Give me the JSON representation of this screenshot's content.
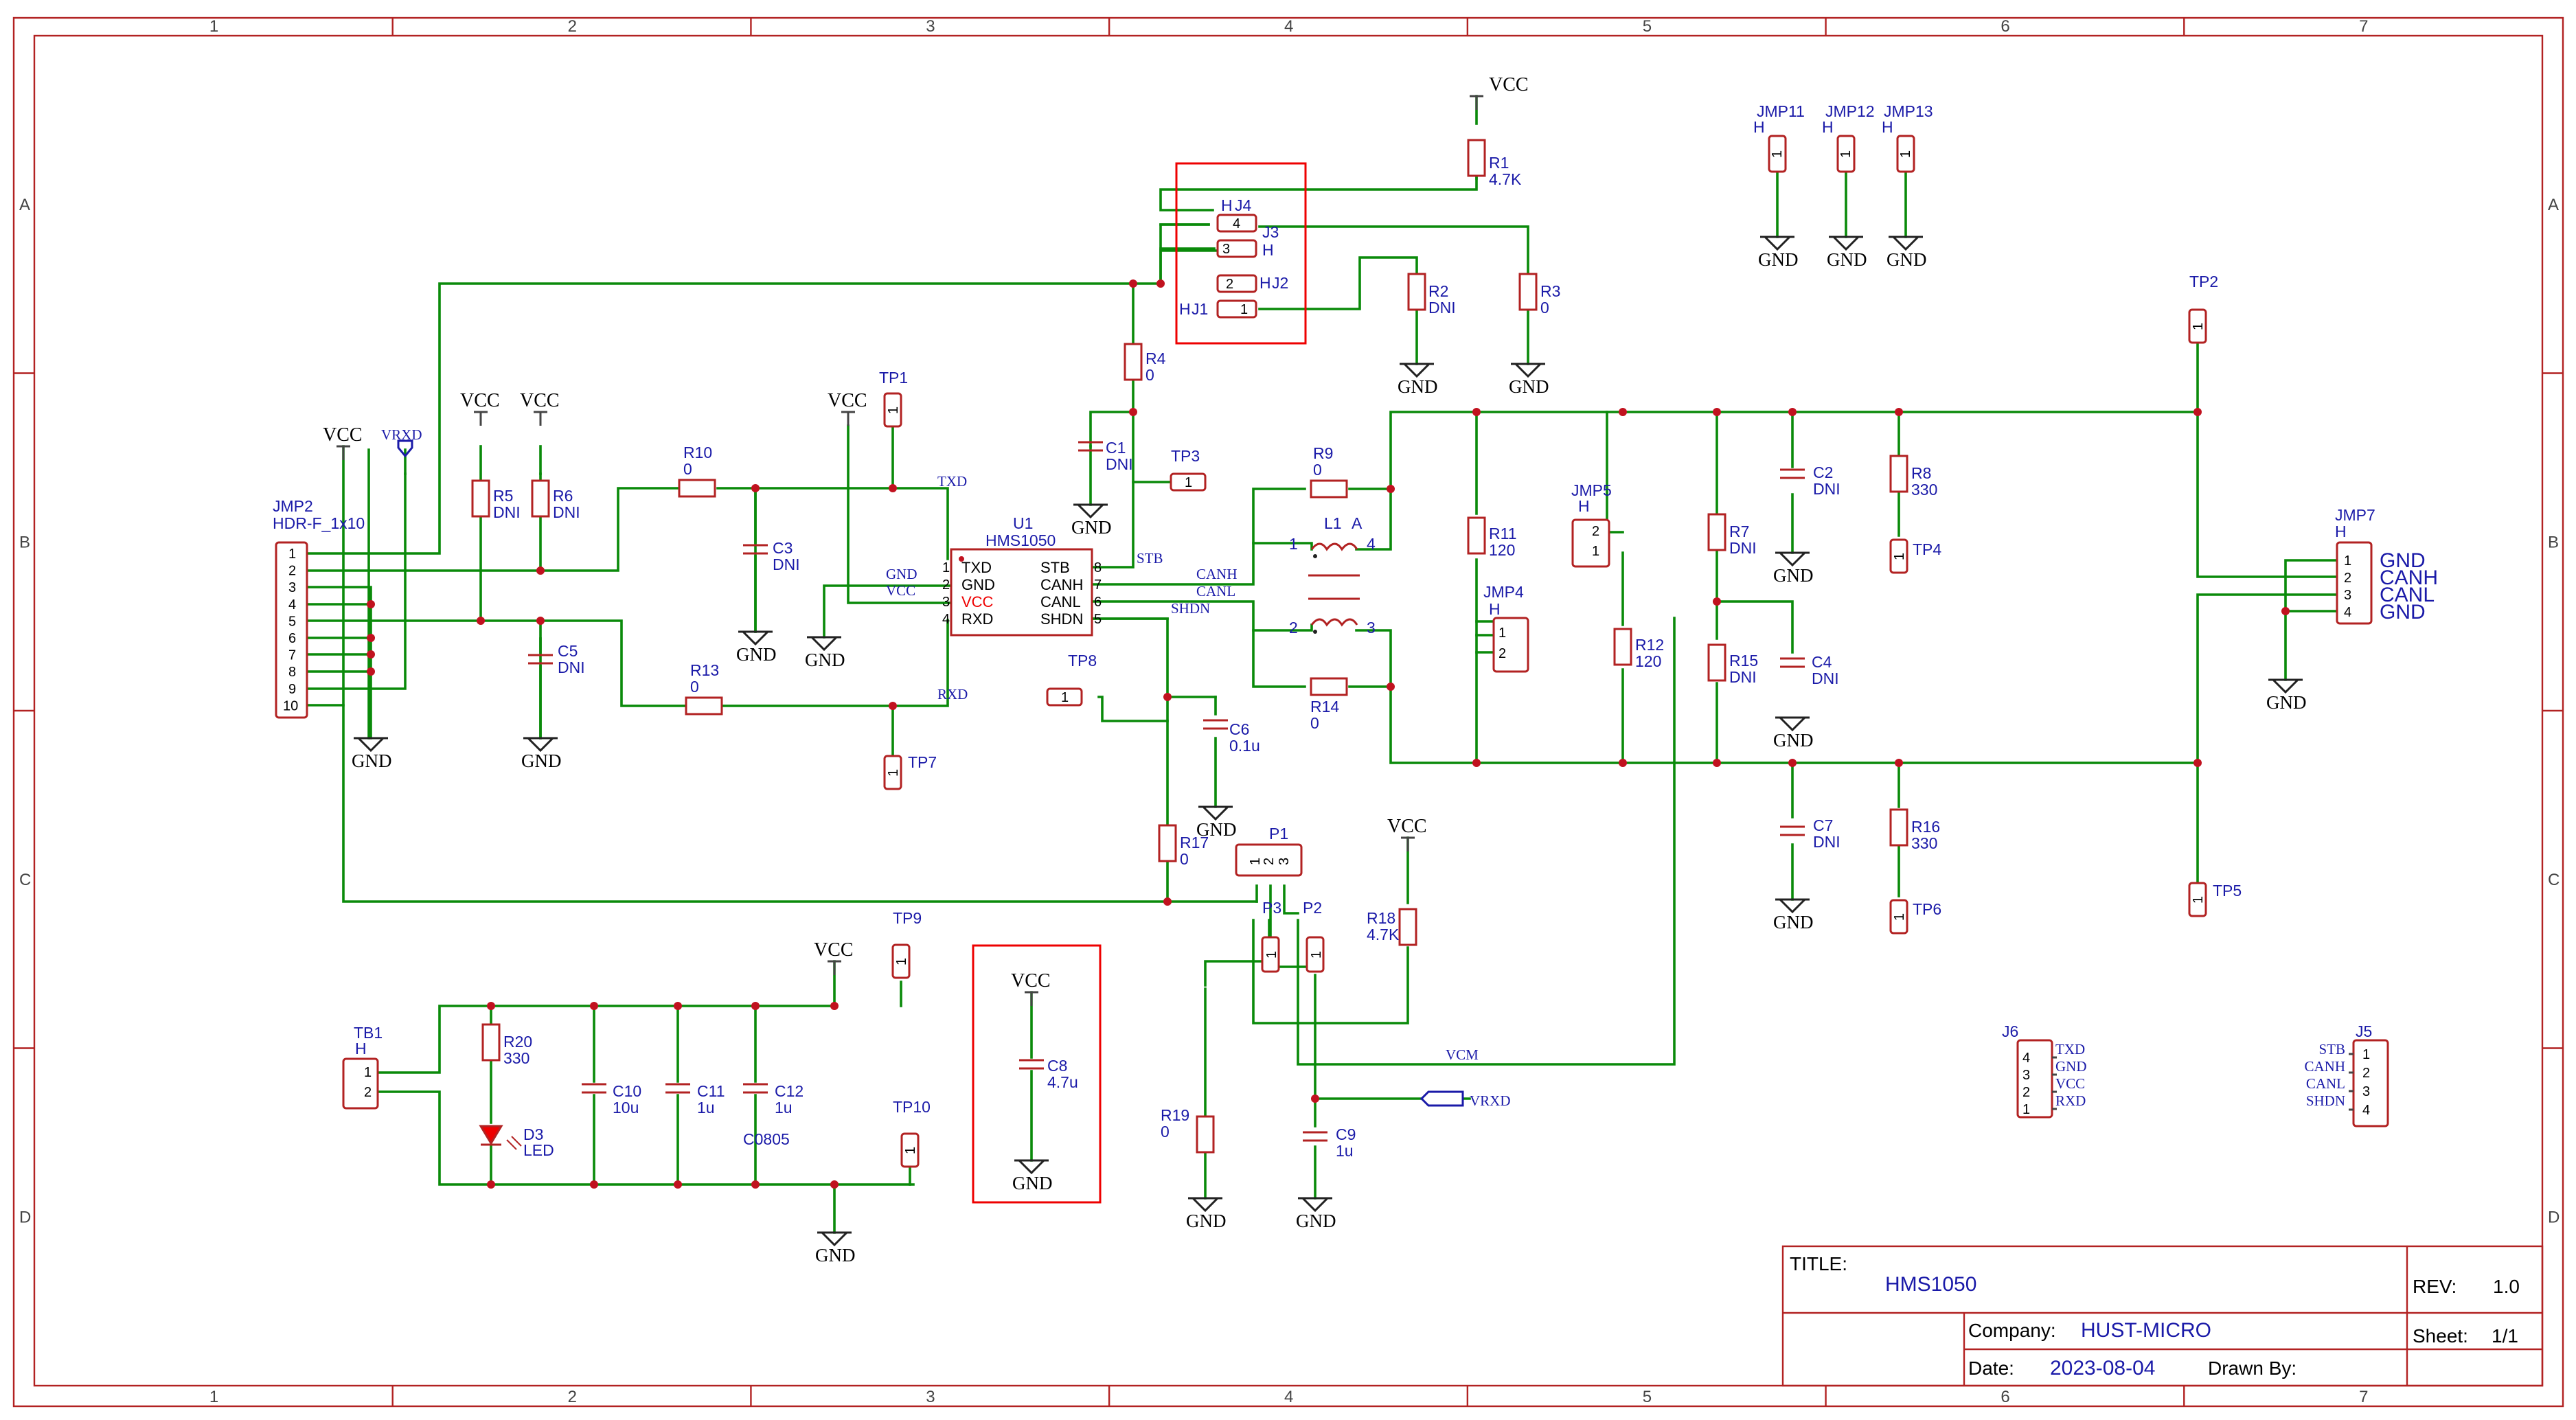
{
  "frame": {
    "columns": [
      "1",
      "2",
      "3",
      "4",
      "5",
      "6",
      "7"
    ],
    "rows": [
      "A",
      "B",
      "C",
      "D"
    ]
  },
  "title_block": {
    "title_label": "TITLE:",
    "title": "HMS1050",
    "rev_label": "REV:",
    "rev": "1.0",
    "company_label": "Company:",
    "company": "HUST-MICRO",
    "sheet_label": "Sheet:",
    "sheet": "1/1",
    "date_label": "Date:",
    "date": "2023-08-04",
    "drawn_label": "Drawn By:"
  },
  "power": {
    "vcc": "VCC",
    "gnd": "GND"
  },
  "nets": {
    "vrxd": "VRXD",
    "vcm": "VCM",
    "txd": "TXD",
    "rxd": "RXD",
    "stb": "STB",
    "canh": "CANH",
    "canl": "CANL",
    "shdn": "SHDN",
    "gnd": "GND",
    "vcc": "VCC"
  },
  "jmp2": {
    "ref": "JMP2",
    "value": "HDR-F_1x10",
    "pins": [
      "1",
      "2",
      "3",
      "4",
      "5",
      "6",
      "7",
      "8",
      "9",
      "10"
    ]
  },
  "u1": {
    "ref": "U1",
    "value": "HMS1050",
    "left_pins": [
      {
        "num": "1",
        "name": "TXD"
      },
      {
        "num": "2",
        "name": "GND"
      },
      {
        "num": "3",
        "name": "VCC"
      },
      {
        "num": "4",
        "name": "RXD"
      }
    ],
    "right_pins": [
      {
        "num": "8",
        "name": "STB"
      },
      {
        "num": "7",
        "name": "CANH"
      },
      {
        "num": "6",
        "name": "CANL"
      },
      {
        "num": "5",
        "name": "SHDN"
      }
    ]
  },
  "resistors": {
    "r1": {
      "ref": "R1",
      "value": "4.7K"
    },
    "r2": {
      "ref": "R2",
      "value": "DNI"
    },
    "r3": {
      "ref": "R3",
      "value": "0"
    },
    "r4": {
      "ref": "R4",
      "value": "0"
    },
    "r5": {
      "ref": "R5",
      "value": "DNI"
    },
    "r6": {
      "ref": "R6",
      "value": "DNI"
    },
    "r7": {
      "ref": "R7",
      "value": "DNI"
    },
    "r8": {
      "ref": "R8",
      "value": "330"
    },
    "r9": {
      "ref": "R9",
      "value": "0"
    },
    "r10": {
      "ref": "R10",
      "value": "0"
    },
    "r11": {
      "ref": "R11",
      "value": "120"
    },
    "r12": {
      "ref": "R12",
      "value": "120"
    },
    "r13": {
      "ref": "R13",
      "value": "0"
    },
    "r14": {
      "ref": "R14",
      "value": "0"
    },
    "r15": {
      "ref": "R15",
      "value": "DNI"
    },
    "r16": {
      "ref": "R16",
      "value": "330"
    },
    "r17": {
      "ref": "R17",
      "value": "0"
    },
    "r18": {
      "ref": "R18",
      "value": "4.7K"
    },
    "r19": {
      "ref": "R19",
      "value": "0"
    },
    "r20": {
      "ref": "R20",
      "value": "330"
    }
  },
  "capacitors": {
    "c1": {
      "ref": "C1",
      "value": "DNI"
    },
    "c2": {
      "ref": "C2",
      "value": "DNI"
    },
    "c3": {
      "ref": "C3",
      "value": "DNI"
    },
    "c4": {
      "ref": "C4",
      "value": "DNI"
    },
    "c5": {
      "ref": "C5",
      "value": "DNI"
    },
    "c6": {
      "ref": "C6",
      "value": "0.1u"
    },
    "c7": {
      "ref": "C7",
      "value": "DNI"
    },
    "c8": {
      "ref": "C8",
      "value": "4.7u"
    },
    "c9": {
      "ref": "C9",
      "value": "1u"
    },
    "c10": {
      "ref": "C10",
      "value": "10u"
    },
    "c11": {
      "ref": "C11",
      "value": "1u"
    },
    "c12": {
      "ref": "C12",
      "value": "1u"
    },
    "c0805": "C0805"
  },
  "inductor": {
    "ref": "L1",
    "value": "A",
    "pins": [
      "1",
      "2",
      "3",
      "4"
    ]
  },
  "led": {
    "ref": "D3",
    "value": "LED"
  },
  "testpoints": {
    "tp1": "TP1",
    "tp2": "TP2",
    "tp3": "TP3",
    "tp4": "TP4",
    "tp5": "TP5",
    "tp6": "TP6",
    "tp7": "TP7",
    "tp8": "TP8",
    "tp9": "TP9",
    "tp10": "TP10",
    "pin": "1"
  },
  "jumpers": {
    "jmp11": "JMP11",
    "jmp12": "JMP12",
    "jmp13": "JMP13",
    "h": "H",
    "jmp4": "JMP4",
    "jmp5": "JMP5",
    "jmp7": "JMP7",
    "j1": "J1",
    "j2": "J2",
    "j3": "J3",
    "j4": "J4",
    "p1": "P1",
    "p2": "P2",
    "p3": "P3",
    "tb1": "TB1",
    "j5": "J5",
    "j6": "J6"
  },
  "jmp7_labels": [
    "GND",
    "CANH",
    "CANL",
    "GND"
  ],
  "j6_labels": [
    "TXD",
    "GND",
    "VCC",
    "RXD"
  ],
  "j5_labels": [
    "STB",
    "CANH",
    "CANL",
    "SHDN"
  ]
}
